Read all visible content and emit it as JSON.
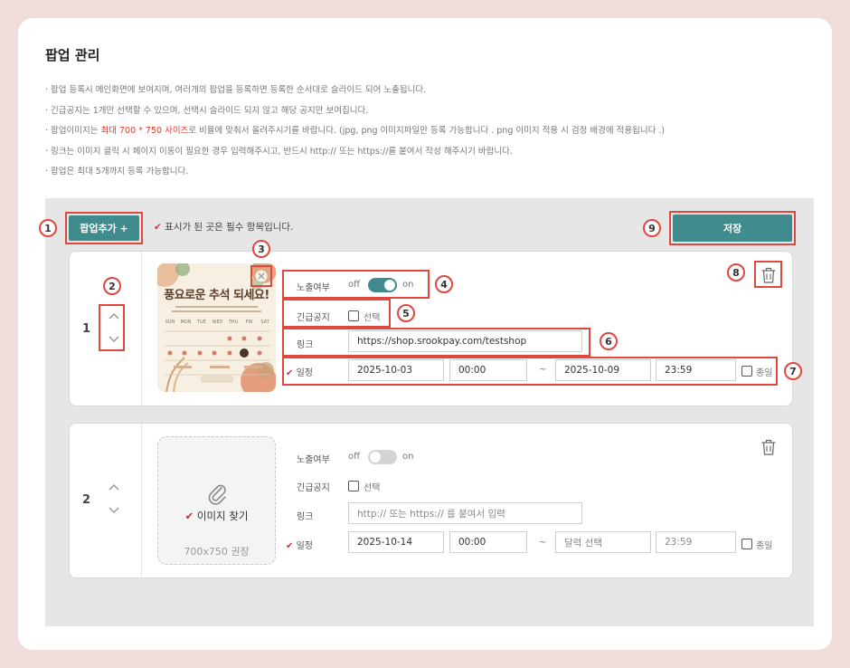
{
  "page": {
    "title": "팝업 관리",
    "notes": [
      {
        "text": "· 팝업 등록시 메인화면에 보여지며, 여러개의 팝업을 등록하면 등록한 순서대로 슬라이드 되어 노출됩니다."
      },
      {
        "text": "· 긴급공지는 1개만 선택할 수 있으며, 선택시 슬라이드 되지 않고 해당 공지만 보여집니다."
      },
      {
        "pre": "· 팝업이미지는 ",
        "highlight": "최대 700 * 750 사이즈",
        "post": "로 비율에 맞춰서 올려주시기를 바랍니다. (jpg, png 이미지파일만 등록 가능합니다 . png 이미지 적용 시 검정 배경에 적용됩니다 .)"
      },
      {
        "text": "· 링크는 이미지 클릭 시 페이지 이동이 필요한 경우 입력해주시고, 반드시 http:// 또는 https://를 붙여서 작성 해주시기 바랍니다."
      },
      {
        "text": "· 팝업은 최대 5개까지 등록 가능합니다."
      }
    ]
  },
  "toolbar": {
    "add_label": "팝업추가 +",
    "required_note": "표시가 된 곳은 필수 항목입니다.",
    "save_label": "저장"
  },
  "labels": {
    "exposure": "노출여부",
    "urgent": "긴급공지",
    "link": "링크",
    "schedule": "일정",
    "off": "off",
    "on": "on",
    "select": "선택",
    "allday": "종일",
    "tilde": "~",
    "check": "✔"
  },
  "popups": [
    {
      "number": "1",
      "exposure_on": true,
      "urgent_checked": false,
      "link_value": "https://shop.srookpay.com/testshop",
      "start_date": "2025-10-03",
      "start_time": "00:00",
      "end_date": "2025-10-09",
      "end_time": "23:59",
      "allday_checked": false,
      "image_title": "풍요로운 추석 되세요!",
      "calendar_days": [
        "SUN",
        "MON",
        "TUE",
        "WED",
        "THU",
        "FRI",
        "SAT"
      ]
    },
    {
      "number": "2",
      "exposure_on": false,
      "urgent_checked": false,
      "link_placeholder": "http:// 또는 https:// 를 붙여서 입력",
      "start_date": "2025-10-14",
      "start_time": "00:00",
      "end_date_placeholder": "달력 선택",
      "end_time_placeholder": "23:59",
      "allday_checked": false,
      "upload_label": "이미지 찾기",
      "upload_hint": "700x750 권장"
    }
  ],
  "annotations": [
    "1",
    "2",
    "3",
    "4",
    "5",
    "6",
    "7",
    "8",
    "9"
  ],
  "colors": {
    "teal": "#3f8b8e",
    "accent_red": "#e0483f",
    "required": "#c8343b"
  }
}
